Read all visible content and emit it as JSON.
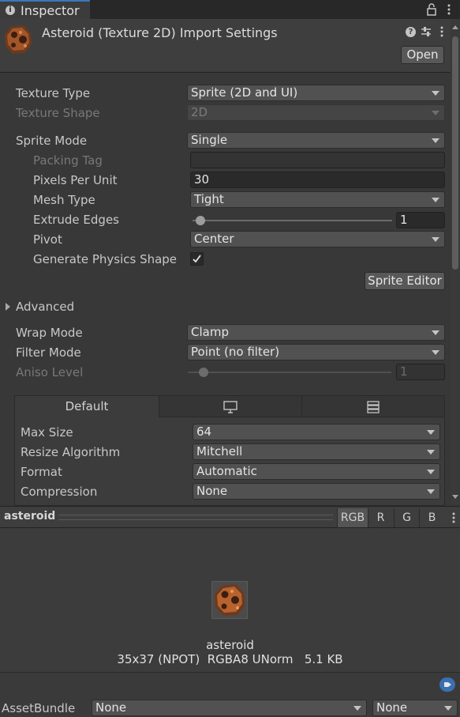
{
  "window": {
    "tab_label": "Inspector"
  },
  "header": {
    "title": "Asteroid (Texture 2D) Import Settings",
    "open_button": "Open"
  },
  "settings": {
    "texture_type": {
      "label": "Texture Type",
      "value": "Sprite (2D and UI)"
    },
    "texture_shape": {
      "label": "Texture Shape",
      "value": "2D"
    },
    "sprite_mode": {
      "label": "Sprite Mode",
      "value": "Single"
    },
    "packing_tag": {
      "label": "Packing Tag",
      "value": ""
    },
    "pixels_per_unit": {
      "label": "Pixels Per Unit",
      "value": "30"
    },
    "mesh_type": {
      "label": "Mesh Type",
      "value": "Tight"
    },
    "extrude_edges": {
      "label": "Extrude Edges",
      "value": "1",
      "slider_fraction": 0.03
    },
    "pivot": {
      "label": "Pivot",
      "value": "Center"
    },
    "physics_shape": {
      "label": "Generate Physics Shape",
      "checked": true
    },
    "sprite_editor_button": "Sprite Editor",
    "advanced": {
      "label": "Advanced"
    },
    "wrap_mode": {
      "label": "Wrap Mode",
      "value": "Clamp"
    },
    "filter_mode": {
      "label": "Filter Mode",
      "value": "Point (no filter)"
    },
    "aniso_level": {
      "label": "Aniso Level",
      "value": "1",
      "slider_fraction": 0.08
    }
  },
  "platform": {
    "tabs": [
      {
        "label": "Default",
        "icon": ""
      },
      {
        "label": "",
        "icon": "monitor-icon"
      },
      {
        "label": "",
        "icon": "server-icon"
      }
    ],
    "max_size": {
      "label": "Max Size",
      "value": "64"
    },
    "resize_algorithm": {
      "label": "Resize Algorithm",
      "value": "Mitchell"
    },
    "format": {
      "label": "Format",
      "value": "Automatic"
    },
    "compression": {
      "label": "Compression",
      "value": "None"
    }
  },
  "preview": {
    "name": "asteroid",
    "channels": [
      "RGB",
      "R",
      "G",
      "B"
    ],
    "active_channel": "RGB",
    "asset_name": "asteroid",
    "info": "35x37 (NPOT)  RGBA8 UNorm   5.1 KB"
  },
  "footer": {
    "assetbundle_label": "AssetBundle",
    "bundle_value": "None",
    "variant_value": "None"
  },
  "colors": {
    "accent": "#3a79bb",
    "background": "#383838",
    "field": "#515151"
  }
}
